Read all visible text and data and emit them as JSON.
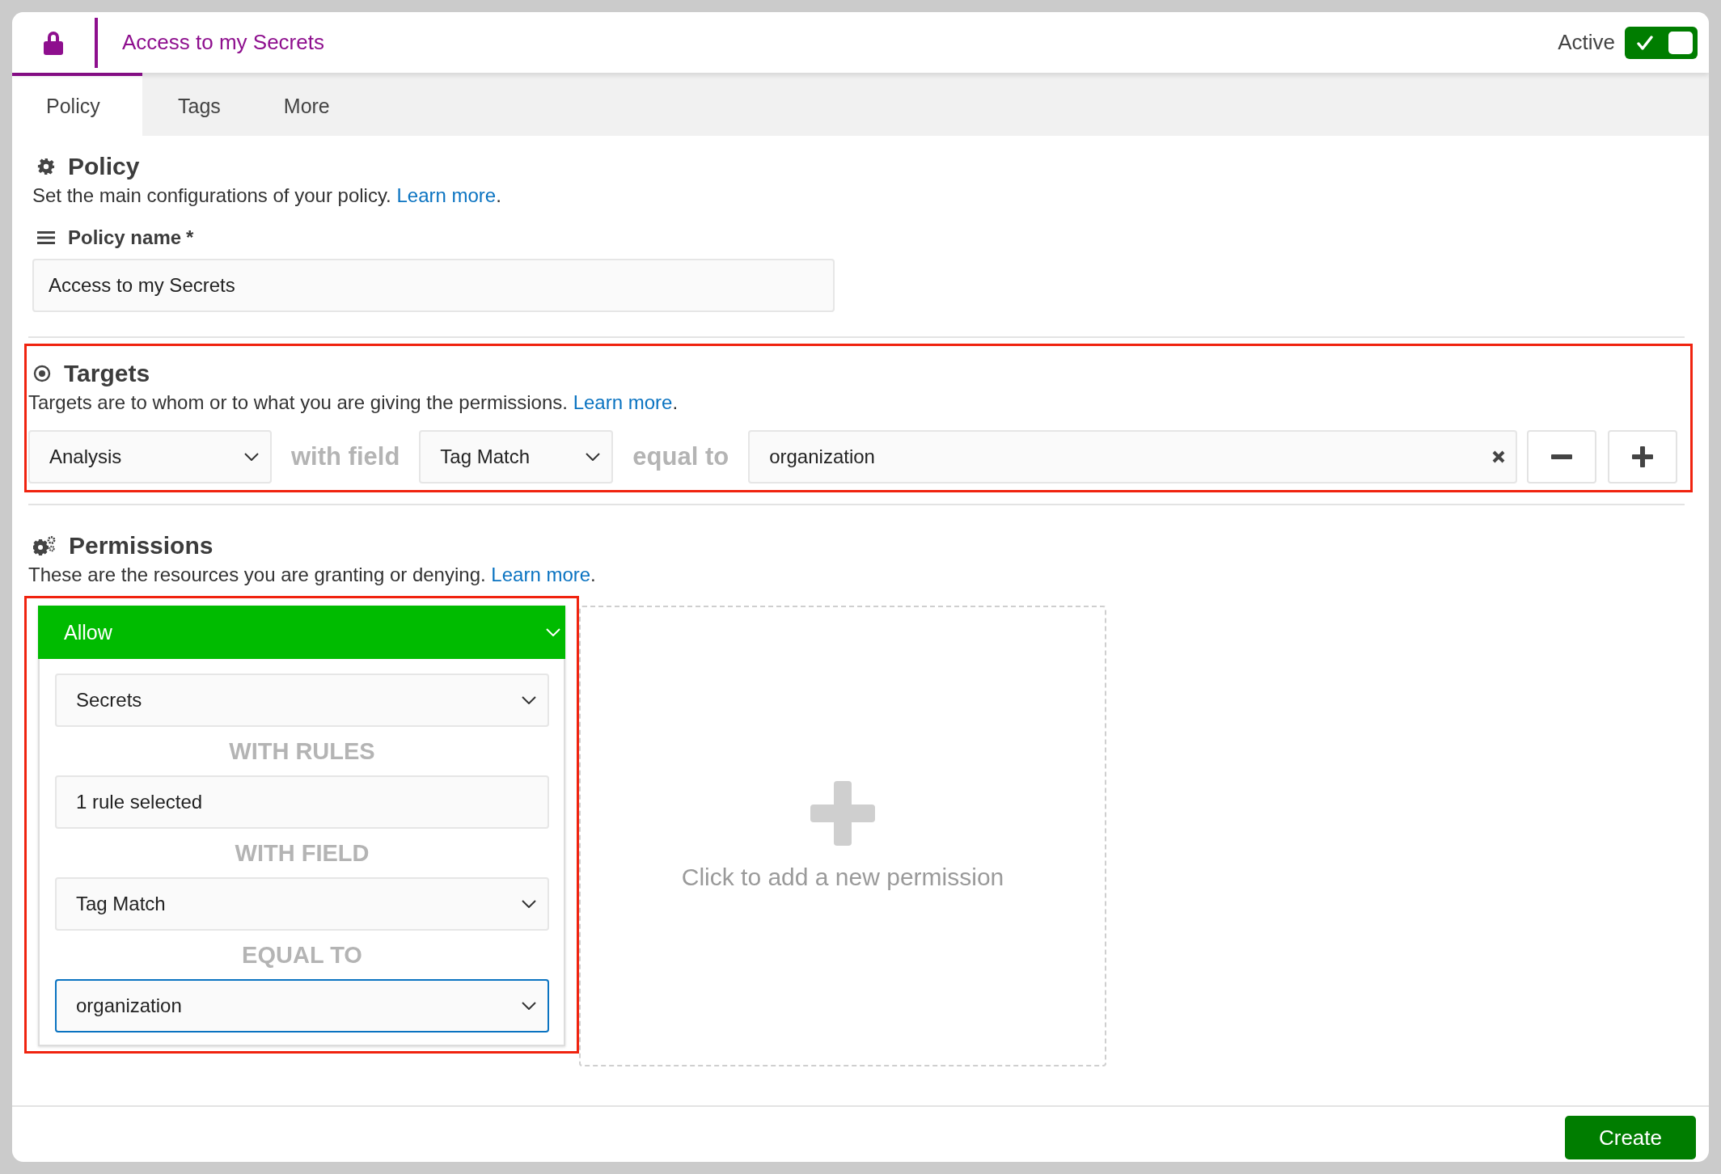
{
  "header": {
    "title": "Access to my Secrets",
    "active_label": "Active",
    "active": true
  },
  "tabs": [
    {
      "label": "Policy",
      "selected": true
    },
    {
      "label": "Tags",
      "selected": false
    },
    {
      "label": "More",
      "selected": false
    }
  ],
  "policy": {
    "title": "Policy",
    "description": "Set the main configurations of your policy.",
    "link": "Learn more",
    "after_link": ".",
    "name_label": "Policy name",
    "required_mark": "*",
    "name_value": "Access to my Secrets"
  },
  "targets": {
    "title": "Targets",
    "description": "Targets are to whom or to what you are giving the permissions.",
    "link": "Learn more",
    "after_link": ".",
    "highlighted": true,
    "entity": "Analysis",
    "with_field": "with field",
    "field": "Tag Match",
    "equal_to": "equal to",
    "value": "organization"
  },
  "permissions": {
    "title": "Permissions",
    "description": "These are the resources you are granting or denying.",
    "link": "Learn more",
    "after_link": ".",
    "highlighted": true,
    "rules": [
      {
        "kind": "allow",
        "effect": "Allow",
        "resource": "Secrets",
        "with_rules": "WITH RULES",
        "rules_value": "1 rule selected",
        "with_field": "WITH FIELD",
        "field": "Tag Match",
        "equal_to": "EQUAL TO",
        "value": "organization",
        "focused": true
      }
    ],
    "add_label": "Click to add a new permission"
  },
  "footer": {
    "create": "Create"
  }
}
